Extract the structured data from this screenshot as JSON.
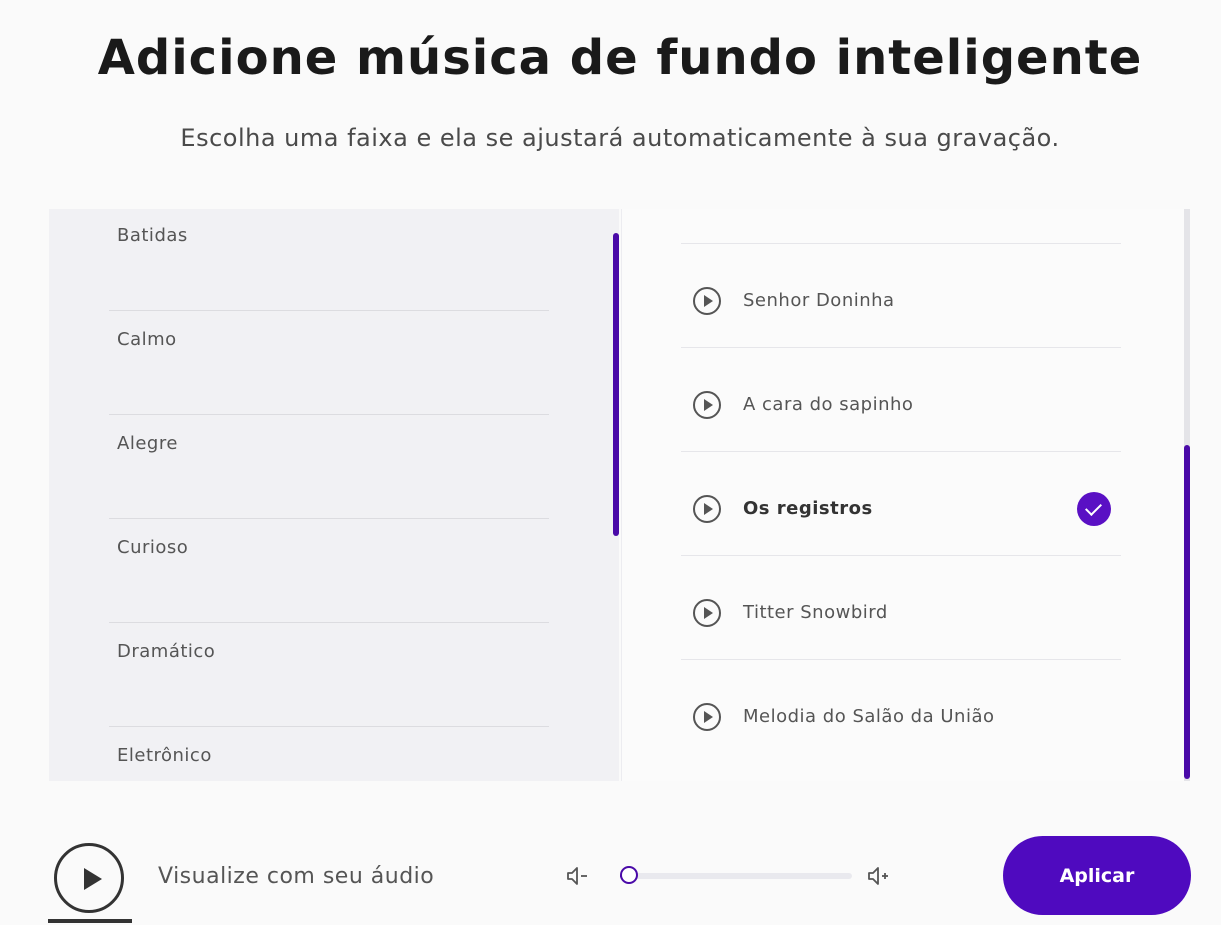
{
  "header": {
    "title": "Adicione música de fundo inteligente",
    "subtitle": "Escolha uma faixa e ela se ajustará automaticamente à sua gravação."
  },
  "categories": {
    "items": [
      {
        "label": "Batidas"
      },
      {
        "label": "Calmo"
      },
      {
        "label": "Alegre"
      },
      {
        "label": "Curioso"
      },
      {
        "label": "Dramático"
      },
      {
        "label": "Eletrônico"
      }
    ]
  },
  "tracks": {
    "items": [
      {
        "label": "Senhor Doninha",
        "selected": false
      },
      {
        "label": "A cara do sapinho",
        "selected": false
      },
      {
        "label": "Os registros",
        "selected": true
      },
      {
        "label": "Titter Snowbird",
        "selected": false
      },
      {
        "label": "Melodia do Salão da União",
        "selected": false
      }
    ],
    "selected_label": "Os registros"
  },
  "footer": {
    "preview_label": "Visualize com seu áudio",
    "volume_level": 0.04,
    "apply_label": "Aplicar"
  },
  "colors": {
    "accent": "#4f0abf",
    "scrollbar": "#4a0aa8"
  },
  "icons": {
    "track_play": "play-circle-icon",
    "selected": "check-circle-icon",
    "preview": "play-circle-icon",
    "volume_down": "volume-down-icon",
    "volume_up": "volume-up-icon"
  }
}
